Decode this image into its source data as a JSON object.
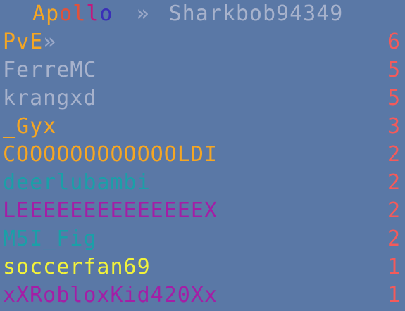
{
  "header": {
    "server_letters": [
      {
        "ch": "A",
        "color": "#f5a623"
      },
      {
        "ch": "p",
        "color": "#f5a623"
      },
      {
        "ch": "o",
        "color": "#e0523c"
      },
      {
        "ch": "l",
        "color": "#e0523c"
      },
      {
        "ch": "l",
        "color": "#c2187d"
      },
      {
        "ch": "o",
        "color": "#3a2fb8"
      }
    ],
    "separator": "»",
    "separator_color": "#9aa8c8",
    "player": "Sharkbob94349",
    "player_color": "#a7b2cc"
  },
  "scoreboard": {
    "rows": [
      {
        "name": "PvE",
        "suffix": " »",
        "name_color": "#f5a623",
        "suffix_color": "#9aa8c8",
        "score": "6",
        "score_color": "#f45a5a"
      },
      {
        "name": "FerreMC",
        "name_color": "#a7b2cc",
        "score": "5",
        "score_color": "#f45a5a"
      },
      {
        "name": "krangxd",
        "name_color": "#a7b2cc",
        "score": "5",
        "score_color": "#f45a5a"
      },
      {
        "name": "_Gyx",
        "name_color": "#f5a623",
        "score": "3",
        "score_color": "#f45a5a"
      },
      {
        "name": "COOOOOOOOOOOOLDI",
        "name_color": "#f5a623",
        "score": "2",
        "score_color": "#f45a5a"
      },
      {
        "name": "deerlubambi",
        "name_color": "#1aa0a8",
        "score": "2",
        "score_color": "#f45a5a"
      },
      {
        "name": "LEEEEEEEEEEEEEEX",
        "name_color": "#a41ea6",
        "score": "2",
        "score_color": "#f45a5a"
      },
      {
        "name": "M5I_Fig",
        "name_color": "#1aa0a8",
        "score": "2",
        "score_color": "#f45a5a"
      },
      {
        "name": "soccerfan69",
        "name_color": "#f2f23a",
        "score": "1",
        "score_color": "#f45a5a"
      },
      {
        "name": "xXRobloxKid420Xx",
        "name_color": "#a41ea6",
        "score": "1",
        "score_color": "#f45a5a"
      }
    ]
  }
}
